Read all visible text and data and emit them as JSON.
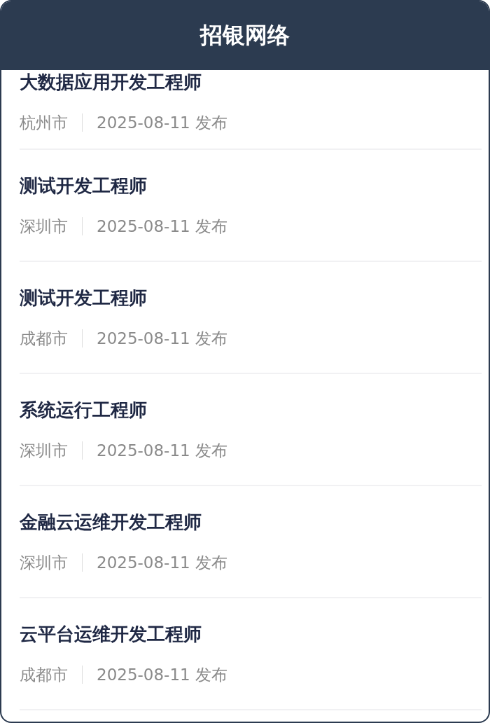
{
  "header": {
    "title": "招银网络"
  },
  "jobs": [
    {
      "title": "大数据应用开发工程师",
      "city": "杭州市",
      "date": "2025-08-11 发布"
    },
    {
      "title": "测试开发工程师",
      "city": "深圳市",
      "date": "2025-08-11 发布"
    },
    {
      "title": "测试开发工程师",
      "city": "成都市",
      "date": "2025-08-11 发布"
    },
    {
      "title": "系统运行工程师",
      "city": "深圳市",
      "date": "2025-08-11 发布"
    },
    {
      "title": "金融云运维开发工程师",
      "city": "深圳市",
      "date": "2025-08-11 发布"
    },
    {
      "title": "云平台运维开发工程师",
      "city": "成都市",
      "date": "2025-08-11 发布"
    }
  ]
}
